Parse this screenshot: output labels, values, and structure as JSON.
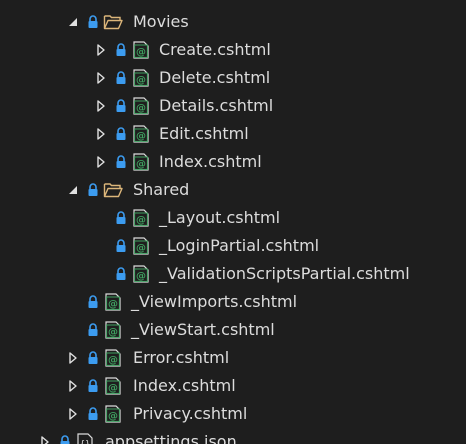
{
  "tree": {
    "items": [
      {
        "label": "Movies",
        "icon": "folder-open-icon",
        "expander": "expanded"
      },
      {
        "label": "Create.cshtml",
        "icon": "razor-file-icon",
        "expander": "collapsed"
      },
      {
        "label": "Delete.cshtml",
        "icon": "razor-file-icon",
        "expander": "collapsed"
      },
      {
        "label": "Details.cshtml",
        "icon": "razor-file-icon",
        "expander": "collapsed"
      },
      {
        "label": "Edit.cshtml",
        "icon": "razor-file-icon",
        "expander": "collapsed"
      },
      {
        "label": "Index.cshtml",
        "icon": "razor-file-icon",
        "expander": "collapsed"
      },
      {
        "label": "Shared",
        "icon": "folder-open-icon",
        "expander": "expanded"
      },
      {
        "label": "_Layout.cshtml",
        "icon": "razor-file-icon",
        "expander": "none"
      },
      {
        "label": "_LoginPartial.cshtml",
        "icon": "razor-file-icon",
        "expander": "none"
      },
      {
        "label": "_ValidationScriptsPartial.cshtml",
        "icon": "razor-file-icon",
        "expander": "none"
      },
      {
        "label": "_ViewImports.cshtml",
        "icon": "razor-file-icon",
        "expander": "none"
      },
      {
        "label": "_ViewStart.cshtml",
        "icon": "razor-file-icon",
        "expander": "none"
      },
      {
        "label": "Error.cshtml",
        "icon": "razor-file-icon",
        "expander": "collapsed"
      },
      {
        "label": "Index.cshtml",
        "icon": "razor-file-icon",
        "expander": "collapsed"
      },
      {
        "label": "Privacy.cshtml",
        "icon": "razor-file-icon",
        "expander": "collapsed"
      },
      {
        "label": "appsettings.json",
        "icon": "json-file-icon",
        "expander": "collapsed"
      }
    ]
  },
  "colors": {
    "background": "#1e1e1e",
    "text": "#dcdcdc",
    "lock": "#3c9cf0",
    "folder": "#dcb67a",
    "file_border": "#3f9f5f",
    "arrow": "#e0e0e0"
  }
}
